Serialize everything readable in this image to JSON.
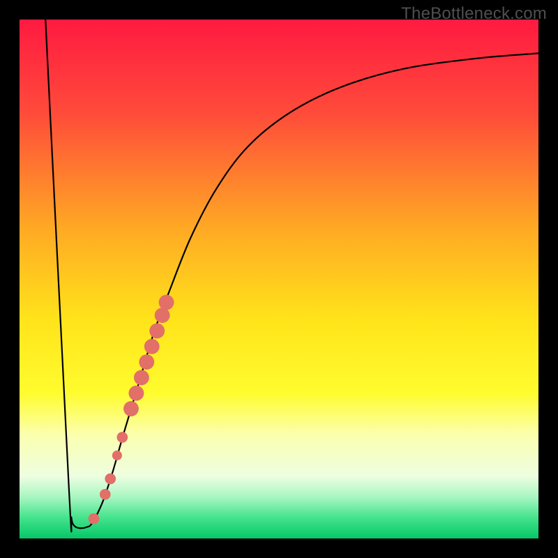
{
  "watermark": "TheBottleneck.com",
  "chart_data": {
    "type": "line",
    "title": "",
    "xlabel": "",
    "ylabel": "",
    "xlim": [
      0,
      100
    ],
    "ylim": [
      0,
      100
    ],
    "gradient_stops": [
      {
        "offset": 0.0,
        "color": "#ff1a41"
      },
      {
        "offset": 0.18,
        "color": "#ff4b3a"
      },
      {
        "offset": 0.4,
        "color": "#ffa824"
      },
      {
        "offset": 0.58,
        "color": "#ffe41a"
      },
      {
        "offset": 0.72,
        "color": "#fffc2e"
      },
      {
        "offset": 0.8,
        "color": "#fbffae"
      },
      {
        "offset": 0.88,
        "color": "#eefee1"
      },
      {
        "offset": 0.92,
        "color": "#a8f6c2"
      },
      {
        "offset": 0.96,
        "color": "#44e38c"
      },
      {
        "offset": 1.0,
        "color": "#05c767"
      }
    ],
    "series": [
      {
        "name": "bottleneck-curve",
        "points": [
          {
            "x": 5.0,
            "y": 100.0
          },
          {
            "x": 9.5,
            "y": 10.0
          },
          {
            "x": 10.0,
            "y": 4.0
          },
          {
            "x": 10.5,
            "y": 2.5
          },
          {
            "x": 11.5,
            "y": 2.0
          },
          {
            "x": 13.0,
            "y": 2.2
          },
          {
            "x": 14.0,
            "y": 3.0
          },
          {
            "x": 16.0,
            "y": 7.0
          },
          {
            "x": 18.0,
            "y": 13.0
          },
          {
            "x": 20.0,
            "y": 20.0
          },
          {
            "x": 23.0,
            "y": 30.0
          },
          {
            "x": 26.0,
            "y": 40.0
          },
          {
            "x": 29.0,
            "y": 48.0
          },
          {
            "x": 33.0,
            "y": 58.0
          },
          {
            "x": 38.0,
            "y": 67.5
          },
          {
            "x": 44.0,
            "y": 75.5
          },
          {
            "x": 52.0,
            "y": 82.0
          },
          {
            "x": 62.0,
            "y": 87.0
          },
          {
            "x": 74.0,
            "y": 90.5
          },
          {
            "x": 88.0,
            "y": 92.5
          },
          {
            "x": 100.0,
            "y": 93.5
          }
        ]
      }
    ],
    "markers": [
      {
        "x": 14.3,
        "y": 3.8,
        "r": 1.0
      },
      {
        "x": 16.5,
        "y": 8.5,
        "r": 1.0
      },
      {
        "x": 17.5,
        "y": 11.5,
        "r": 1.0
      },
      {
        "x": 18.8,
        "y": 16.0,
        "r": 0.9
      },
      {
        "x": 19.8,
        "y": 19.5,
        "r": 1.0
      },
      {
        "x": 21.5,
        "y": 25.0,
        "r": 1.4
      },
      {
        "x": 22.5,
        "y": 28.0,
        "r": 1.4
      },
      {
        "x": 23.5,
        "y": 31.0,
        "r": 1.4
      },
      {
        "x": 24.5,
        "y": 34.0,
        "r": 1.4
      },
      {
        "x": 25.5,
        "y": 37.0,
        "r": 1.4
      },
      {
        "x": 26.5,
        "y": 40.0,
        "r": 1.4
      },
      {
        "x": 27.5,
        "y": 43.0,
        "r": 1.4
      },
      {
        "x": 28.3,
        "y": 45.5,
        "r": 1.4
      }
    ]
  }
}
